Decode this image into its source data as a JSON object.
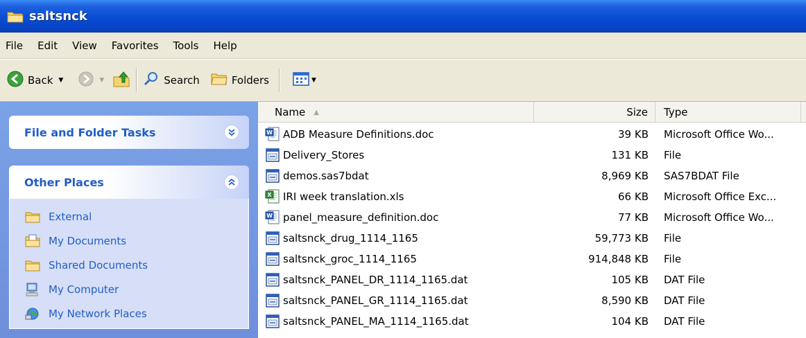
{
  "window": {
    "title": "saltsnck",
    "title_icon": "folder-icon"
  },
  "menu": [
    "File",
    "Edit",
    "View",
    "Favorites",
    "Tools",
    "Help"
  ],
  "toolbar": {
    "back_label": "Back",
    "search_label": "Search",
    "folders_label": "Folders"
  },
  "left_pane": {
    "file_tasks": {
      "title": "File and Folder Tasks",
      "state": "collapsed"
    },
    "other_places": {
      "title": "Other Places",
      "state": "expanded",
      "items": [
        {
          "label": "External",
          "icon": "folder-icon"
        },
        {
          "label": "My Documents",
          "icon": "my-documents-icon"
        },
        {
          "label": "Shared Documents",
          "icon": "folder-icon"
        },
        {
          "label": "My Computer",
          "icon": "computer-icon"
        },
        {
          "label": "My Network Places",
          "icon": "network-icon"
        }
      ]
    }
  },
  "columns": {
    "name": "Name",
    "size": "Size",
    "type": "Type"
  },
  "files": [
    {
      "name": "ADB Measure Definitions.doc",
      "size": "39 KB",
      "type": "Microsoft Office Wo...",
      "icon": "word-doc-icon"
    },
    {
      "name": "Delivery_Stores",
      "size": "131 KB",
      "type": "File",
      "icon": "sas-file-icon"
    },
    {
      "name": "demos.sas7bdat",
      "size": "8,969 KB",
      "type": "SAS7BDAT File",
      "icon": "sas-file-icon"
    },
    {
      "name": "IRI week translation.xls",
      "size": "66 KB",
      "type": "Microsoft Office Exc...",
      "icon": "excel-icon"
    },
    {
      "name": "panel_measure_definition.doc",
      "size": "77 KB",
      "type": "Microsoft Office Wo...",
      "icon": "word-doc-icon"
    },
    {
      "name": "saltsnck_drug_1114_1165",
      "size": "59,773 KB",
      "type": "File",
      "icon": "sas-file-icon"
    },
    {
      "name": "saltsnck_groc_1114_1165",
      "size": "914,848 KB",
      "type": "File",
      "icon": "sas-file-icon"
    },
    {
      "name": "saltsnck_PANEL_DR_1114_1165.dat",
      "size": "105 KB",
      "type": "DAT File",
      "icon": "sas-file-icon"
    },
    {
      "name": "saltsnck_PANEL_GR_1114_1165.dat",
      "size": "8,590 KB",
      "type": "DAT File",
      "icon": "sas-file-icon"
    },
    {
      "name": "saltsnck_PANEL_MA_1114_1165.dat",
      "size": "104 KB",
      "type": "DAT File",
      "icon": "sas-file-icon"
    }
  ]
}
